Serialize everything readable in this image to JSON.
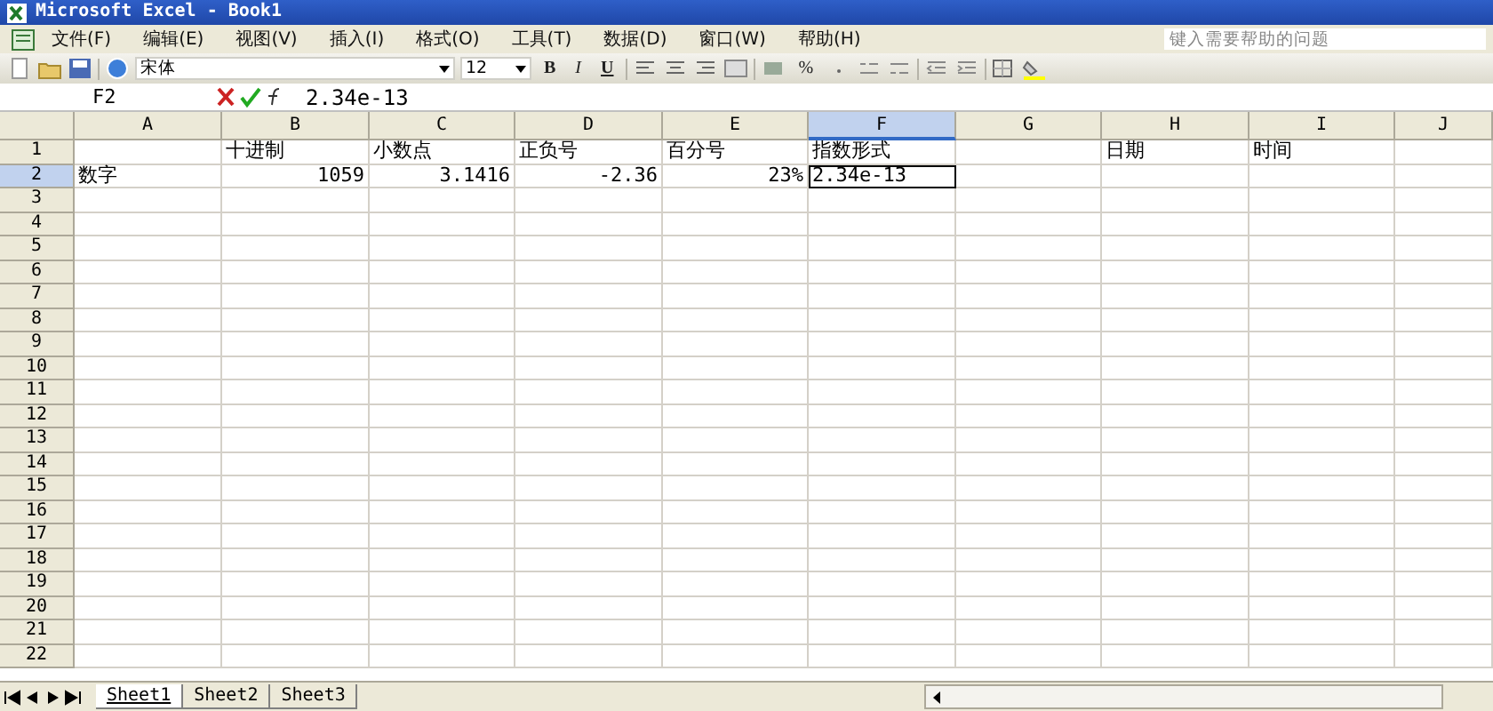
{
  "window": {
    "title": "Microsoft Excel - Book1"
  },
  "menu": [
    "文件(F)",
    "编辑(E)",
    "视图(V)",
    "插入(I)",
    "格式(O)",
    "工具(T)",
    "数据(D)",
    "窗口(W)",
    "帮助(H)"
  ],
  "help_search": {
    "placeholder": "键入需要帮助的问题"
  },
  "toolbar": {
    "font": "宋体",
    "size": "12",
    "format_buttons": [
      "B",
      "I",
      "U"
    ],
    "percent": "%"
  },
  "formula_bar": {
    "name_box": "F2",
    "value": "2.34e-13"
  },
  "columns": [
    {
      "label": "A",
      "selected": false
    },
    {
      "label": "B",
      "selected": false
    },
    {
      "label": "C",
      "selected": false
    },
    {
      "label": "D",
      "selected": false
    },
    {
      "label": "E",
      "selected": false
    },
    {
      "label": "F",
      "selected": true
    },
    {
      "label": "G",
      "selected": false
    },
    {
      "label": "H",
      "selected": false
    },
    {
      "label": "I",
      "selected": false
    },
    {
      "label": "J",
      "selected": false
    }
  ],
  "rows": [
    {
      "label": "1",
      "selected": false,
      "cells": [
        null,
        {
          "text": "十进制",
          "kind": "text"
        },
        {
          "text": "小数点",
          "kind": "text"
        },
        {
          "text": "正负号",
          "kind": "text"
        },
        {
          "text": "百分号",
          "kind": "text"
        },
        {
          "text": "指数形式",
          "kind": "text"
        },
        null,
        {
          "text": "日期",
          "kind": "text"
        },
        {
          "text": "时间",
          "kind": "text"
        },
        null
      ]
    },
    {
      "label": "2",
      "selected": true,
      "cells": [
        {
          "text": "数字",
          "kind": "text"
        },
        {
          "text": "1059",
          "kind": "number"
        },
        {
          "text": "3.1416",
          "kind": "number"
        },
        {
          "text": "-2.36",
          "kind": "number"
        },
        {
          "text": "23%",
          "kind": "number"
        },
        {
          "text": "2.34e-13",
          "kind": "text",
          "active": true
        },
        null,
        null,
        null,
        null
      ]
    },
    {
      "label": "3",
      "selected": false
    },
    {
      "label": "4",
      "selected": false
    },
    {
      "label": "5",
      "selected": false
    },
    {
      "label": "6",
      "selected": false
    },
    {
      "label": "7",
      "selected": false
    },
    {
      "label": "8",
      "selected": false
    },
    {
      "label": "9",
      "selected": false
    },
    {
      "label": "10",
      "selected": false
    },
    {
      "label": "11",
      "selected": false
    },
    {
      "label": "12",
      "selected": false
    },
    {
      "label": "13",
      "selected": false
    },
    {
      "label": "14",
      "selected": false
    },
    {
      "label": "15",
      "selected": false
    },
    {
      "label": "16",
      "selected": false
    },
    {
      "label": "17",
      "selected": false
    },
    {
      "label": "18",
      "selected": false
    },
    {
      "label": "19",
      "selected": false
    },
    {
      "label": "20",
      "selected": false
    },
    {
      "label": "21",
      "selected": false
    },
    {
      "label": "22",
      "selected": false
    }
  ],
  "sheets": [
    {
      "label": "Sheet1",
      "selected": true
    },
    {
      "label": "Sheet2",
      "selected": false
    },
    {
      "label": "Sheet3",
      "selected": false
    }
  ]
}
